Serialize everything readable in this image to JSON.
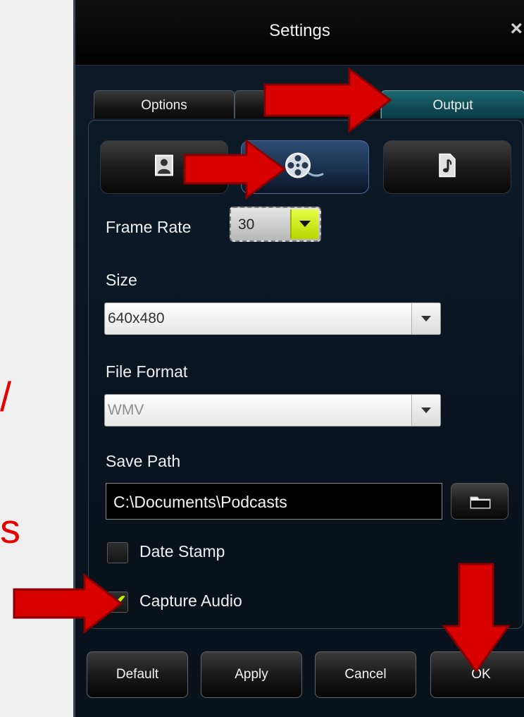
{
  "left_marks": [
    "/",
    "s"
  ],
  "dialog": {
    "title": "Settings",
    "close_glyph": "×"
  },
  "tabs": [
    {
      "label": "Options",
      "active": false
    },
    {
      "label": "",
      "active": false
    },
    {
      "label": "Output",
      "active": true
    }
  ],
  "sub_tabs": [
    {
      "icon": "user-image-icon",
      "active": false
    },
    {
      "icon": "film-reel-icon",
      "active": true
    },
    {
      "icon": "music-note-icon",
      "active": false
    }
  ],
  "form": {
    "frame_rate_label": "Frame Rate",
    "frame_rate_value": "30",
    "size_label": "Size",
    "size_value": "640x480",
    "file_format_label": "File Format",
    "file_format_value": "WMV",
    "save_path_label": "Save Path",
    "save_path_value": "C:\\Documents\\Podcasts",
    "browse_icon": "folder-icon",
    "date_stamp_label": "Date Stamp",
    "date_stamp_checked": false,
    "capture_audio_label": "Capture Audio",
    "capture_audio_checked": true,
    "check_glyph": "✔"
  },
  "footer": {
    "default_label": "Default",
    "apply_label": "Apply",
    "cancel_label": "Cancel",
    "ok_label": "OK"
  },
  "colors": {
    "annotation_red": "#e00000",
    "accent_yellow_green": "#c8f000",
    "active_tab_teal": "#1d6a73"
  }
}
